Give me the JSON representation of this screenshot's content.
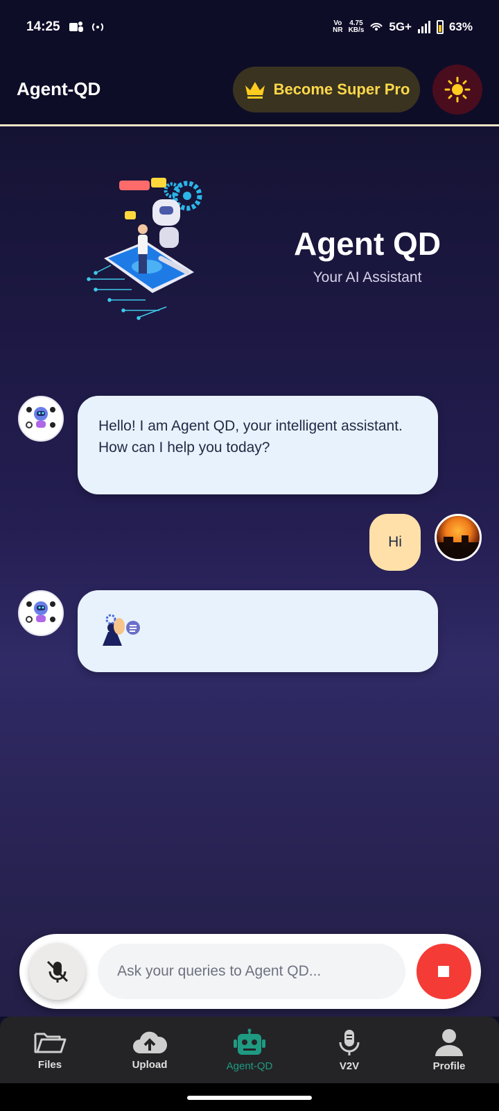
{
  "status_bar": {
    "time": "14:25",
    "net_speed_value": "4.75",
    "net_speed_unit": "KB/s",
    "vo_top": "Vo",
    "vo_bottom": "NR",
    "network": "5G+",
    "battery": "63%"
  },
  "header": {
    "title": "Agent-QD",
    "super_pro_label": "Become Super Pro",
    "accent_color": "#ffd84a"
  },
  "hero": {
    "title": "Agent QD",
    "subtitle": "Your AI Assistant"
  },
  "messages": [
    {
      "sender": "bot",
      "text": "Hello! I am Agent QD, your intelligent assistant. How can I help you today?"
    },
    {
      "sender": "user",
      "text": "Hi"
    },
    {
      "sender": "bot",
      "text": "",
      "typing": true
    }
  ],
  "input": {
    "placeholder": "Ask your queries to Agent QD...",
    "value": ""
  },
  "nav": {
    "items": [
      {
        "label": "Files",
        "icon": "folder-icon"
      },
      {
        "label": "Upload",
        "icon": "cloud-upload-icon"
      },
      {
        "label": "Agent-QD",
        "icon": "robot-icon",
        "active": true
      },
      {
        "label": "V2V",
        "icon": "microphone-icon"
      },
      {
        "label": "Profile",
        "icon": "person-icon"
      }
    ],
    "active_color": "#1f9a82"
  }
}
